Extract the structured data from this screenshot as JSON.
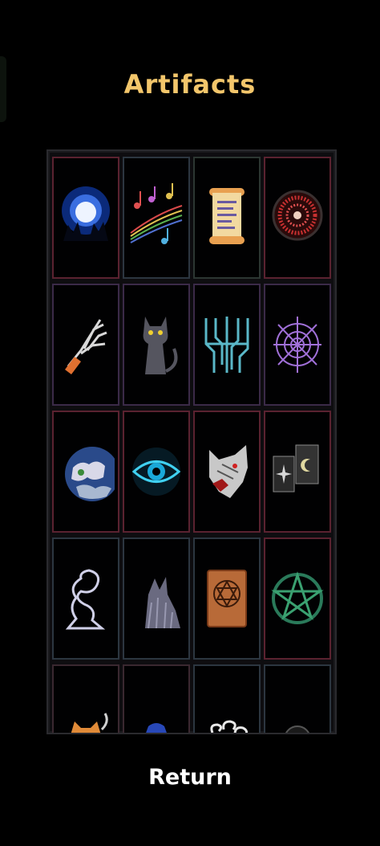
{
  "header": {
    "title": "Artifacts"
  },
  "footer": {
    "return_label": "Return"
  },
  "artifacts": [
    {
      "icon": "moon-howl-icon",
      "border": "#5a2230"
    },
    {
      "icon": "music-notes-icon",
      "border": "#2c3640"
    },
    {
      "icon": "scroll-icon",
      "border": "#2c3632"
    },
    {
      "icon": "rune-circle-icon",
      "border": "#5a2230"
    },
    {
      "icon": "skeleton-hand-icon",
      "border": "#3b2a48"
    },
    {
      "icon": "black-cat-icon",
      "border": "#3b2a48"
    },
    {
      "icon": "circuit-glyph-icon",
      "border": "#3b2a48"
    },
    {
      "icon": "spider-web-icon",
      "border": "#3b2a48"
    },
    {
      "icon": "planet-icon",
      "border": "#5a2230"
    },
    {
      "icon": "eye-icon",
      "border": "#5a2230"
    },
    {
      "icon": "wolf-head-icon",
      "border": "#5a2230"
    },
    {
      "icon": "tarot-cards-icon",
      "border": "#5a2230"
    },
    {
      "icon": "spirit-wisp-icon",
      "border": "#2c3640"
    },
    {
      "icon": "shadow-beast-icon",
      "border": "#2c3640"
    },
    {
      "icon": "hex-book-icon",
      "border": "#2c3640"
    },
    {
      "icon": "pentagram-icon",
      "border": "#5a2230"
    },
    {
      "icon": "mechanical-cat-icon",
      "border": "#3a2830"
    },
    {
      "icon": "wizard-cloak-icon",
      "border": "#3a2830"
    },
    {
      "icon": "wind-swirl-icon",
      "border": "#2c3640"
    },
    {
      "icon": "skull-lantern-icon",
      "border": "#2c3640"
    }
  ]
}
